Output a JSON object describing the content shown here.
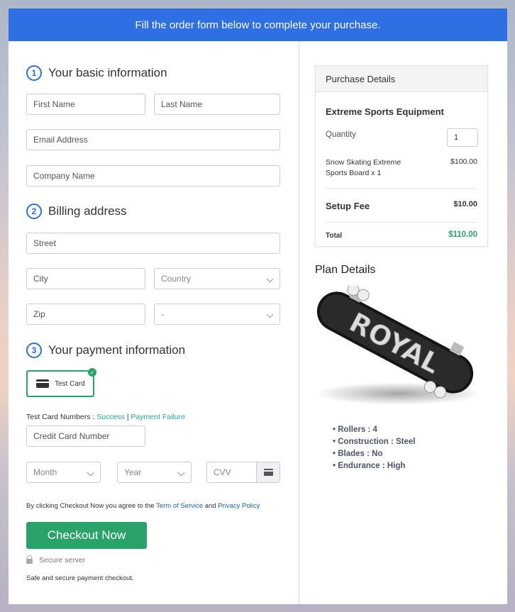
{
  "banner": "Fill the order form below to complete your purchase.",
  "form": {
    "steps": [
      {
        "num": "1",
        "title": "Your basic information"
      },
      {
        "num": "2",
        "title": "Billing address"
      },
      {
        "num": "3",
        "title": "Your payment information"
      }
    ],
    "first_name": "First Name",
    "last_name": "Last Name",
    "email": "Email Address",
    "company": "Company Name",
    "street": "Street",
    "city": "City",
    "country": "Country",
    "zip": "Zip",
    "state": "-",
    "payment_method": "Test Card",
    "test_numbers_label": "Test Card Numbers :",
    "success_link": "Success",
    "separator": "|",
    "failure_link": "Payment Failure",
    "card_number": "Credit Card Number",
    "month": "Month",
    "year": "Year",
    "cvv": "CVV",
    "terms_prefix": "By clicking Checkout Now you agree to the",
    "terms_link": "Term of Service",
    "terms_and": "and",
    "privacy_link": "Privacy Policy",
    "checkout_button": "Checkout Now",
    "secure_label": "Secure server",
    "safe_note": "Safe and secure payment checkout."
  },
  "purchase": {
    "header": "Purchase Details",
    "product": "Extreme Sports Equipment",
    "quantity_label": "Quantity",
    "quantity_value": "1",
    "item_name": "Snow Skating Extreme Sports Board x 1",
    "item_price": "$100.00",
    "setup_label": "Setup Fee",
    "setup_price": "$10.00",
    "total_label": "Total",
    "total_price": "$110.00"
  },
  "plan": {
    "title": "Plan Details",
    "board_text": "ROYAL",
    "features": [
      "Rollers : 4",
      "Construction : Steel",
      "Blades : No",
      "Endurance : High"
    ]
  },
  "colors": {
    "primary": "#2f6fe4",
    "accent_green": "#2aa36b",
    "link_teal": "#26a69a",
    "link_blue": "#1a5fb4"
  },
  "icons": [
    "credit-card-icon",
    "check-icon",
    "chevron-down-icon",
    "lock-icon"
  ]
}
